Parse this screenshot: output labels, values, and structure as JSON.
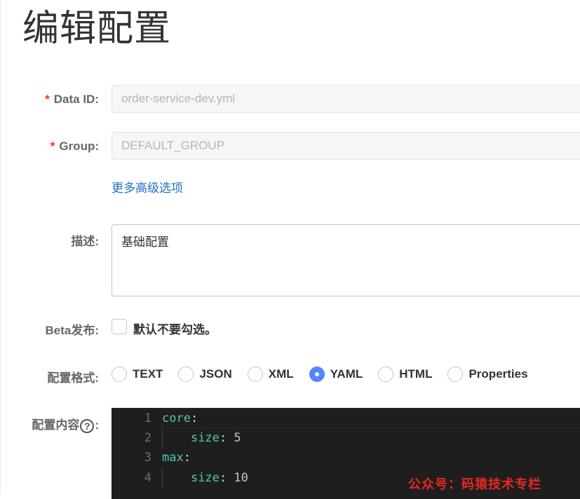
{
  "page": {
    "title": "编辑配置"
  },
  "form": {
    "data_id": {
      "label": "Data ID:",
      "required_mark": "*",
      "value": "order-service-dev.yml"
    },
    "group": {
      "label": "Group:",
      "required_mark": "*",
      "value": "DEFAULT_GROUP"
    },
    "advanced_link": "更多高级选项",
    "description": {
      "label": "描述:",
      "value": "基础配置"
    },
    "beta": {
      "label": "Beta发布:",
      "checked": false,
      "checkbox_label": "默认不要勾选。"
    },
    "format": {
      "label": "配置格式:",
      "selected": "YAML",
      "options": [
        "TEXT",
        "JSON",
        "XML",
        "YAML",
        "HTML",
        "Properties"
      ]
    },
    "content": {
      "label_prefix": "配置内容",
      "help_icon": "question-circle-icon",
      "help_glyph": "?",
      "label_suffix": ":",
      "lines": [
        {
          "num": "1",
          "key": "core",
          "colon": ":",
          "value": "",
          "indent": false
        },
        {
          "num": "2",
          "key": "size",
          "colon": ":",
          "value": "5",
          "indent": true
        },
        {
          "num": "3",
          "key": "max",
          "colon": ":",
          "value": "",
          "indent": false
        },
        {
          "num": "4",
          "key": "size",
          "colon": ":",
          "value": "10",
          "indent": true
        }
      ]
    }
  },
  "watermark": "公众号：码猿技术专栏",
  "colors": {
    "accent": "#5584ff",
    "link": "#1f6fc7",
    "required": "#ff3000",
    "editor_bg": "#1e1e1e",
    "yaml_key": "#4ec9b0",
    "yaml_number": "#b5cea8"
  }
}
